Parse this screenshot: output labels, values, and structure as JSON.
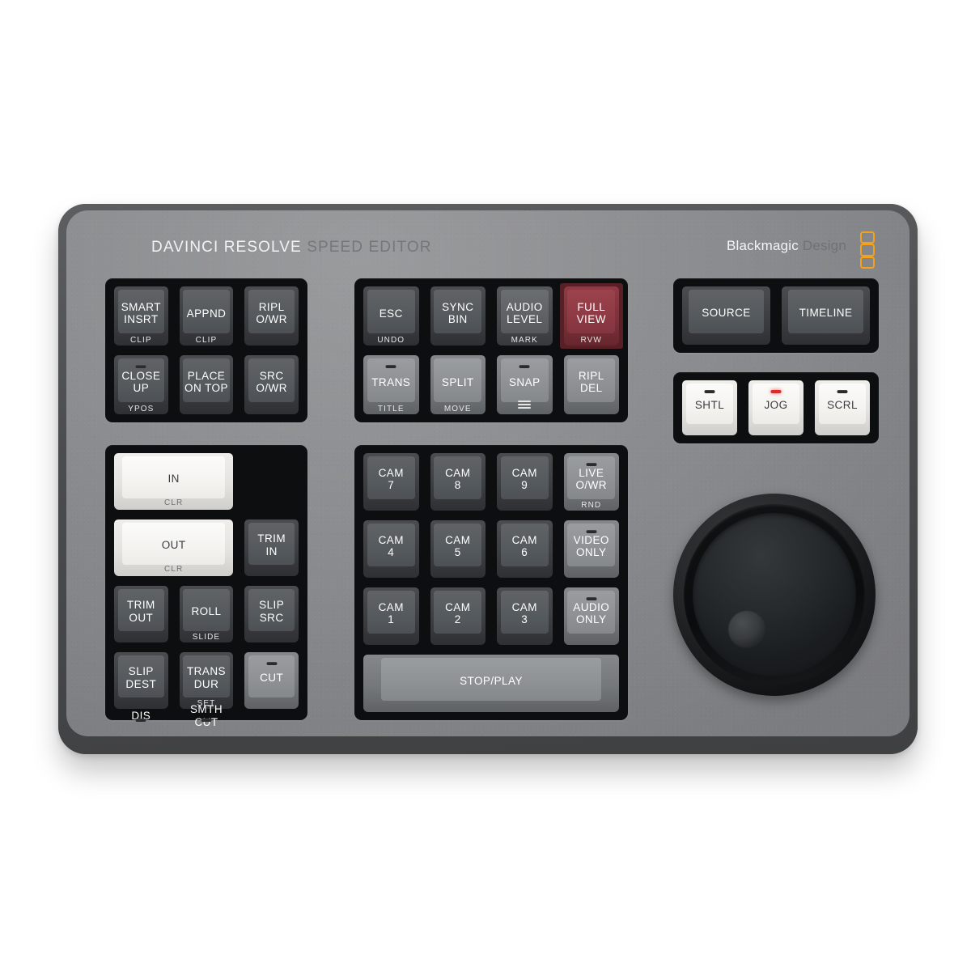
{
  "device": {
    "brand_left_primary": "DAVINCI RESOLVE",
    "brand_left_secondary": "SPEED EDITOR",
    "brand_right_primary": "Blackmagic",
    "brand_right_secondary": "Design",
    "logo_mark": "three-orange-rounded-squares"
  },
  "colors": {
    "chassis": "#7c7d80",
    "bezel": "#0d0e0f",
    "key_gray": "#3c3e41",
    "key_light": "#75787b",
    "key_white": "#e4e3df",
    "key_red": "#7d313a",
    "led_on": "#e02a2a",
    "led_off": "#2a2b2d",
    "brand_orange": "#f5a21a"
  },
  "blocks": {
    "edit_functions": {
      "name": "edit-functions-block",
      "keys": [
        {
          "label": "SMART\nINSRT",
          "sub": "CLIP",
          "style": "k-gray",
          "led": "none"
        },
        {
          "label": "APPND",
          "sub": "CLIP",
          "style": "k-gray",
          "led": "none"
        },
        {
          "label": "RIPL\nO/WR",
          "sub": "",
          "style": "k-gray",
          "led": "none"
        },
        {
          "label": "CLOSE\nUP",
          "sub": "YPOS",
          "style": "k-gray",
          "led": "off"
        },
        {
          "label": "PLACE\nON TOP",
          "sub": "",
          "style": "k-gray",
          "led": "none"
        },
        {
          "label": "SRC\nO/WR",
          "sub": "",
          "style": "k-gray",
          "led": "none"
        }
      ]
    },
    "timeline_tools": {
      "name": "timeline-tools-block",
      "keys": [
        {
          "label": "ESC",
          "sub": "UNDO",
          "style": "k-gray",
          "led": "none",
          "cell": ""
        },
        {
          "label": "SYNC\nBIN",
          "sub": "",
          "style": "k-gray",
          "led": "none",
          "cell": ""
        },
        {
          "label": "AUDIO\nLEVEL",
          "sub": "MARK",
          "style": "k-midgray",
          "led": "none",
          "cell": "darkcell"
        },
        {
          "label": "FULL\nVIEW",
          "sub": "RVW",
          "style": "k-red",
          "led": "none",
          "cell": "redcell"
        },
        {
          "label": "TRANS",
          "sub": "TITLE",
          "style": "k-light",
          "led": "off",
          "cell": ""
        },
        {
          "label": "SPLIT",
          "sub": "MOVE",
          "style": "k-light",
          "led": "none",
          "cell": ""
        },
        {
          "label": "SNAP",
          "sub": "hamburger",
          "style": "k-light",
          "led": "off",
          "cell": ""
        },
        {
          "label": "RIPL\nDEL",
          "sub": "",
          "style": "k-light",
          "led": "none",
          "cell": ""
        }
      ]
    },
    "view_select": {
      "name": "view-select-block",
      "keys": [
        {
          "label": "SOURCE",
          "sub": "",
          "style": "k-gray",
          "led": "none"
        },
        {
          "label": "TIMELINE",
          "sub": "",
          "style": "k-gray",
          "led": "none"
        }
      ]
    },
    "dial_modes": {
      "name": "dial-mode-block",
      "keys": [
        {
          "label": "SHTL",
          "sub": "",
          "style": "k-white",
          "led": "off"
        },
        {
          "label": "JOG",
          "sub": "",
          "style": "k-white",
          "led": "on"
        },
        {
          "label": "SCRL",
          "sub": "",
          "style": "k-white",
          "led": "off"
        }
      ]
    },
    "trim_tools": {
      "name": "trim-tools-block",
      "keys": [
        {
          "label": "IN",
          "sub": "CLR",
          "style": "k-white",
          "led": "none",
          "wide": true
        },
        {
          "label": "OUT",
          "sub": "CLR",
          "style": "k-white",
          "led": "none",
          "wide": true
        },
        {
          "label": "TRIM\nIN",
          "sub": "",
          "style": "k-gray",
          "led": "none"
        },
        {
          "label": "TRIM\nOUT",
          "sub": "",
          "style": "k-gray",
          "led": "none"
        },
        {
          "label": "ROLL",
          "sub": "SLIDE",
          "style": "k-gray",
          "led": "none"
        },
        {
          "label": "SLIP\nSRC",
          "sub": "",
          "style": "k-gray",
          "led": "none"
        },
        {
          "label": "SLIP\nDEST",
          "sub": "",
          "style": "k-gray",
          "led": "none"
        },
        {
          "label": "TRANS\nDUR",
          "sub": "SET",
          "style": "k-gray",
          "led": "none"
        },
        {
          "label": "CUT",
          "sub": "",
          "style": "k-light",
          "led": "off"
        },
        {
          "label": "DIS",
          "sub": "",
          "style": "k-light",
          "led": "off"
        },
        {
          "label": "SMTH\nCUT",
          "sub": "",
          "style": "k-light",
          "led": "off"
        }
      ]
    },
    "camera_pad": {
      "name": "camera-pad-block",
      "keys": [
        {
          "label": "CAM\n7",
          "sub": "",
          "style": "k-gray",
          "led": "none"
        },
        {
          "label": "CAM\n8",
          "sub": "",
          "style": "k-gray",
          "led": "none"
        },
        {
          "label": "CAM\n9",
          "sub": "",
          "style": "k-gray",
          "led": "none"
        },
        {
          "label": "LIVE\nO/WR",
          "sub": "RND",
          "style": "k-light",
          "led": "off"
        },
        {
          "label": "CAM\n4",
          "sub": "",
          "style": "k-gray",
          "led": "none"
        },
        {
          "label": "CAM\n5",
          "sub": "",
          "style": "k-gray",
          "led": "none"
        },
        {
          "label": "CAM\n6",
          "sub": "",
          "style": "k-gray",
          "led": "none"
        },
        {
          "label": "VIDEO\nONLY",
          "sub": "",
          "style": "k-light",
          "led": "off"
        },
        {
          "label": "CAM\n1",
          "sub": "",
          "style": "k-gray",
          "led": "none"
        },
        {
          "label": "CAM\n2",
          "sub": "",
          "style": "k-gray",
          "led": "none"
        },
        {
          "label": "CAM\n3",
          "sub": "",
          "style": "k-gray",
          "led": "none"
        },
        {
          "label": "AUDIO\nONLY",
          "sub": "",
          "style": "k-light",
          "led": "off"
        }
      ],
      "transport_key": {
        "label": "STOP/PLAY",
        "style": "k-light"
      }
    }
  },
  "search_dial": {
    "name": "search-dial",
    "has_finger_dimple": true
  }
}
